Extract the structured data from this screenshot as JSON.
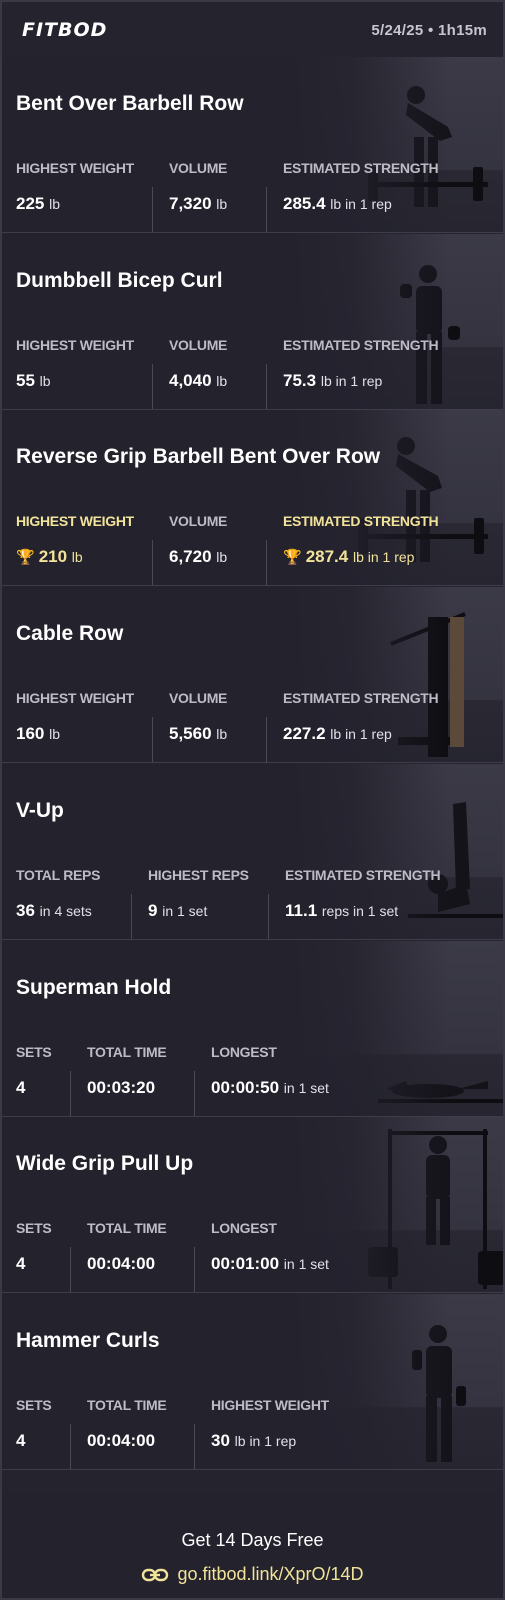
{
  "header": {
    "logo": "FITBOD",
    "meta": "5/24/25 • 1h15m"
  },
  "exercises": [
    {
      "name": "Bent Over Barbell Row",
      "stats": [
        {
          "label": "HIGHEST WEIGHT",
          "value": "225",
          "unit": "lb",
          "record": false
        },
        {
          "label": "VOLUME",
          "value": "7,320",
          "unit": "lb",
          "record": false
        },
        {
          "label": "ESTIMATED STRENGTH",
          "value": "285.4",
          "unit": "lb in 1 rep",
          "record": false
        }
      ]
    },
    {
      "name": "Dumbbell Bicep Curl",
      "stats": [
        {
          "label": "HIGHEST WEIGHT",
          "value": "55",
          "unit": "lb",
          "record": false
        },
        {
          "label": "VOLUME",
          "value": "4,040",
          "unit": "lb",
          "record": false
        },
        {
          "label": "ESTIMATED STRENGTH",
          "value": "75.3",
          "unit": "lb in 1 rep",
          "record": false
        }
      ]
    },
    {
      "name": "Reverse Grip Barbell Bent Over Row",
      "stats": [
        {
          "label": "HIGHEST WEIGHT",
          "value": "210",
          "unit": "lb",
          "record": true
        },
        {
          "label": "VOLUME",
          "value": "6,720",
          "unit": "lb",
          "record": false
        },
        {
          "label": "ESTIMATED STRENGTH",
          "value": "287.4",
          "unit": "lb in 1 rep",
          "record": true
        }
      ]
    },
    {
      "name": "Cable Row",
      "stats": [
        {
          "label": "HIGHEST WEIGHT",
          "value": "160",
          "unit": "lb",
          "record": false
        },
        {
          "label": "VOLUME",
          "value": "5,560",
          "unit": "lb",
          "record": false
        },
        {
          "label": "ESTIMATED STRENGTH",
          "value": "227.2",
          "unit": "lb in 1 rep",
          "record": false
        }
      ]
    },
    {
      "name": "V-Up",
      "stats": [
        {
          "label": "TOTAL REPS",
          "value": "36",
          "unit": "in 4 sets",
          "record": false
        },
        {
          "label": "HIGHEST REPS",
          "value": "9",
          "unit": "in 1 set",
          "record": false
        },
        {
          "label": "ESTIMATED STRENGTH",
          "value": "11.1",
          "unit": "reps in 1 set",
          "record": false
        }
      ]
    },
    {
      "name": "Superman Hold",
      "stats": [
        {
          "label": "SETS",
          "value": "4",
          "unit": "",
          "record": false
        },
        {
          "label": "TOTAL TIME",
          "value": "00:03:20",
          "unit": "",
          "record": false
        },
        {
          "label": "LONGEST",
          "value": "00:00:50",
          "unit": "in 1 set",
          "record": false
        }
      ]
    },
    {
      "name": "Wide Grip Pull Up",
      "stats": [
        {
          "label": "SETS",
          "value": "4",
          "unit": "",
          "record": false
        },
        {
          "label": "TOTAL TIME",
          "value": "00:04:00",
          "unit": "",
          "record": false
        },
        {
          "label": "LONGEST",
          "value": "00:01:00",
          "unit": "in 1 set",
          "record": false
        }
      ]
    },
    {
      "name": "Hammer Curls",
      "stats": [
        {
          "label": "SETS",
          "value": "4",
          "unit": "",
          "record": false
        },
        {
          "label": "TOTAL TIME",
          "value": "00:04:00",
          "unit": "",
          "record": false
        },
        {
          "label": "HIGHEST WEIGHT",
          "value": "30",
          "unit": "lb in 1 rep",
          "record": false
        }
      ]
    }
  ],
  "footer": {
    "cta": "Get 14 Days Free",
    "link": "go.fitbod.link/XprO/14D",
    "link_icon": "link-icon"
  },
  "colors": {
    "background": "#23222d",
    "record_gold": "#f2e39a",
    "label_gray": "#bdbbc6"
  },
  "icons": {
    "record": "trophy-icon"
  }
}
